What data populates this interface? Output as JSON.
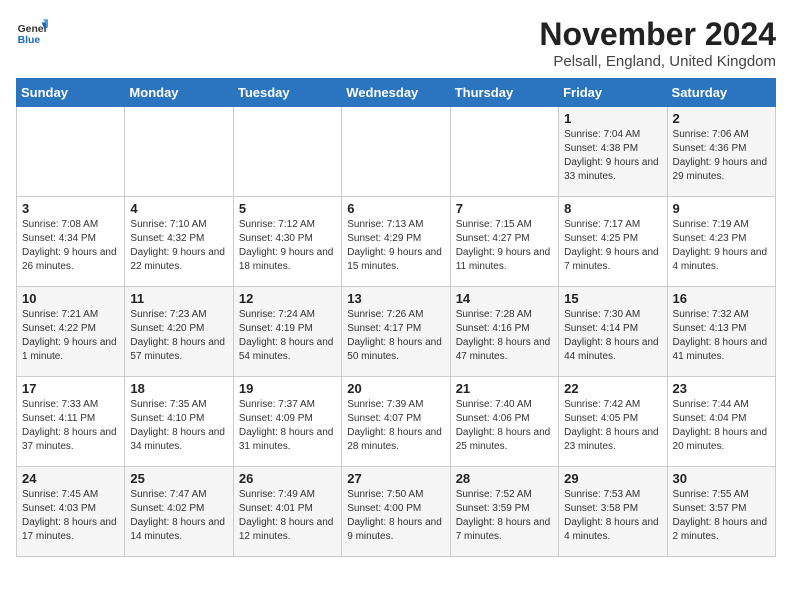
{
  "logo": {
    "general": "General",
    "blue": "Blue"
  },
  "title": "November 2024",
  "location": "Pelsall, England, United Kingdom",
  "days_of_week": [
    "Sunday",
    "Monday",
    "Tuesday",
    "Wednesday",
    "Thursday",
    "Friday",
    "Saturday"
  ],
  "weeks": [
    [
      {
        "day": "",
        "info": ""
      },
      {
        "day": "",
        "info": ""
      },
      {
        "day": "",
        "info": ""
      },
      {
        "day": "",
        "info": ""
      },
      {
        "day": "",
        "info": ""
      },
      {
        "day": "1",
        "info": "Sunrise: 7:04 AM\nSunset: 4:38 PM\nDaylight: 9 hours and 33 minutes."
      },
      {
        "day": "2",
        "info": "Sunrise: 7:06 AM\nSunset: 4:36 PM\nDaylight: 9 hours and 29 minutes."
      }
    ],
    [
      {
        "day": "3",
        "info": "Sunrise: 7:08 AM\nSunset: 4:34 PM\nDaylight: 9 hours and 26 minutes."
      },
      {
        "day": "4",
        "info": "Sunrise: 7:10 AM\nSunset: 4:32 PM\nDaylight: 9 hours and 22 minutes."
      },
      {
        "day": "5",
        "info": "Sunrise: 7:12 AM\nSunset: 4:30 PM\nDaylight: 9 hours and 18 minutes."
      },
      {
        "day": "6",
        "info": "Sunrise: 7:13 AM\nSunset: 4:29 PM\nDaylight: 9 hours and 15 minutes."
      },
      {
        "day": "7",
        "info": "Sunrise: 7:15 AM\nSunset: 4:27 PM\nDaylight: 9 hours and 11 minutes."
      },
      {
        "day": "8",
        "info": "Sunrise: 7:17 AM\nSunset: 4:25 PM\nDaylight: 9 hours and 7 minutes."
      },
      {
        "day": "9",
        "info": "Sunrise: 7:19 AM\nSunset: 4:23 PM\nDaylight: 9 hours and 4 minutes."
      }
    ],
    [
      {
        "day": "10",
        "info": "Sunrise: 7:21 AM\nSunset: 4:22 PM\nDaylight: 9 hours and 1 minute."
      },
      {
        "day": "11",
        "info": "Sunrise: 7:23 AM\nSunset: 4:20 PM\nDaylight: 8 hours and 57 minutes."
      },
      {
        "day": "12",
        "info": "Sunrise: 7:24 AM\nSunset: 4:19 PM\nDaylight: 8 hours and 54 minutes."
      },
      {
        "day": "13",
        "info": "Sunrise: 7:26 AM\nSunset: 4:17 PM\nDaylight: 8 hours and 50 minutes."
      },
      {
        "day": "14",
        "info": "Sunrise: 7:28 AM\nSunset: 4:16 PM\nDaylight: 8 hours and 47 minutes."
      },
      {
        "day": "15",
        "info": "Sunrise: 7:30 AM\nSunset: 4:14 PM\nDaylight: 8 hours and 44 minutes."
      },
      {
        "day": "16",
        "info": "Sunrise: 7:32 AM\nSunset: 4:13 PM\nDaylight: 8 hours and 41 minutes."
      }
    ],
    [
      {
        "day": "17",
        "info": "Sunrise: 7:33 AM\nSunset: 4:11 PM\nDaylight: 8 hours and 37 minutes."
      },
      {
        "day": "18",
        "info": "Sunrise: 7:35 AM\nSunset: 4:10 PM\nDaylight: 8 hours and 34 minutes."
      },
      {
        "day": "19",
        "info": "Sunrise: 7:37 AM\nSunset: 4:09 PM\nDaylight: 8 hours and 31 minutes."
      },
      {
        "day": "20",
        "info": "Sunrise: 7:39 AM\nSunset: 4:07 PM\nDaylight: 8 hours and 28 minutes."
      },
      {
        "day": "21",
        "info": "Sunrise: 7:40 AM\nSunset: 4:06 PM\nDaylight: 8 hours and 25 minutes."
      },
      {
        "day": "22",
        "info": "Sunrise: 7:42 AM\nSunset: 4:05 PM\nDaylight: 8 hours and 23 minutes."
      },
      {
        "day": "23",
        "info": "Sunrise: 7:44 AM\nSunset: 4:04 PM\nDaylight: 8 hours and 20 minutes."
      }
    ],
    [
      {
        "day": "24",
        "info": "Sunrise: 7:45 AM\nSunset: 4:03 PM\nDaylight: 8 hours and 17 minutes."
      },
      {
        "day": "25",
        "info": "Sunrise: 7:47 AM\nSunset: 4:02 PM\nDaylight: 8 hours and 14 minutes."
      },
      {
        "day": "26",
        "info": "Sunrise: 7:49 AM\nSunset: 4:01 PM\nDaylight: 8 hours and 12 minutes."
      },
      {
        "day": "27",
        "info": "Sunrise: 7:50 AM\nSunset: 4:00 PM\nDaylight: 8 hours and 9 minutes."
      },
      {
        "day": "28",
        "info": "Sunrise: 7:52 AM\nSunset: 3:59 PM\nDaylight: 8 hours and 7 minutes."
      },
      {
        "day": "29",
        "info": "Sunrise: 7:53 AM\nSunset: 3:58 PM\nDaylight: 8 hours and 4 minutes."
      },
      {
        "day": "30",
        "info": "Sunrise: 7:55 AM\nSunset: 3:57 PM\nDaylight: 8 hours and 2 minutes."
      }
    ]
  ]
}
